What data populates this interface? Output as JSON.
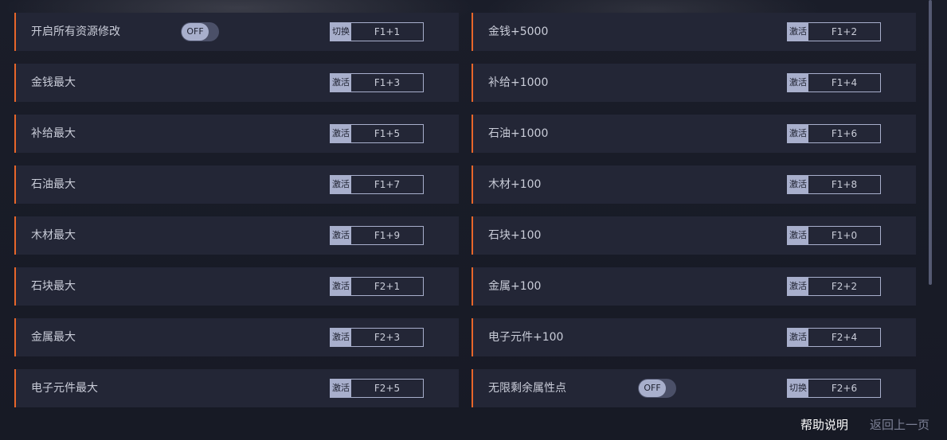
{
  "rows": [
    {
      "label": "开启所有资源修改",
      "toggle": "OFF",
      "action": "切换",
      "keys": "F1+1"
    },
    {
      "label": "金钱+5000",
      "action": "激活",
      "keys": "F1+2"
    },
    {
      "label": "金钱最大",
      "action": "激活",
      "keys": "F1+3"
    },
    {
      "label": "补给+1000",
      "action": "激活",
      "keys": "F1+4"
    },
    {
      "label": "补给最大",
      "action": "激活",
      "keys": "F1+5"
    },
    {
      "label": "石油+1000",
      "action": "激活",
      "keys": "F1+6"
    },
    {
      "label": "石油最大",
      "action": "激活",
      "keys": "F1+7"
    },
    {
      "label": "木材+100",
      "action": "激活",
      "keys": "F1+8"
    },
    {
      "label": "木材最大",
      "action": "激活",
      "keys": "F1+9"
    },
    {
      "label": "石块+100",
      "action": "激活",
      "keys": "F1+0"
    },
    {
      "label": "石块最大",
      "action": "激活",
      "keys": "F2+1"
    },
    {
      "label": "金属+100",
      "action": "激活",
      "keys": "F2+2"
    },
    {
      "label": "金属最大",
      "action": "激活",
      "keys": "F2+3"
    },
    {
      "label": "电子元件+100",
      "action": "激活",
      "keys": "F2+4"
    },
    {
      "label": "电子元件最大",
      "action": "激活",
      "keys": "F2+5"
    },
    {
      "label": "无限剩余属性点",
      "toggle": "OFF",
      "action": "切换",
      "keys": "F2+6"
    }
  ],
  "footer": {
    "help_label": "帮助说明",
    "back_label": "返回上一页"
  },
  "colors": {
    "accent": "#e8662a",
    "row_bg": "#232636",
    "badge": "#a8afcc"
  }
}
